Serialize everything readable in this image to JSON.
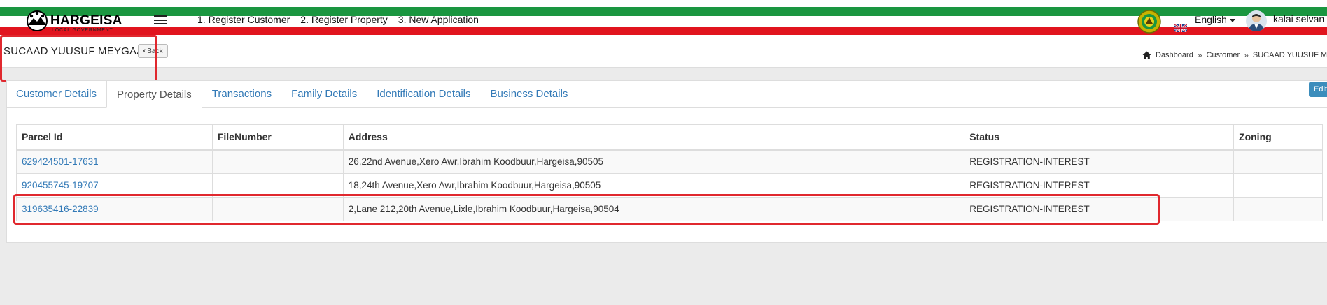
{
  "header": {
    "logo_title": "HARGEISA",
    "logo_subtitle": "LOCAL GOVERNMENT",
    "nav": [
      {
        "label": "1. Register Customer"
      },
      {
        "label": "2. Register Property"
      },
      {
        "label": "3. New Application"
      }
    ],
    "language": "English",
    "username": "kalai selvan"
  },
  "page": {
    "customer_name": "SUCAAD YUUSUF MEYGAAG",
    "back_label": "Back",
    "breadcrumb": [
      "Dashboard",
      "Customer",
      "SUCAAD YUUSUF MEYGAAG"
    ],
    "edit_label": "Edit"
  },
  "tabs": [
    {
      "label": "Customer Details",
      "active": false
    },
    {
      "label": "Property Details",
      "active": true
    },
    {
      "label": "Transactions",
      "active": false
    },
    {
      "label": "Family Details",
      "active": false
    },
    {
      "label": "Identification Details",
      "active": false
    },
    {
      "label": "Business Details",
      "active": false
    }
  ],
  "table": {
    "columns": [
      "Parcel Id",
      "FileNumber",
      "Address",
      "Status",
      "Zoning"
    ],
    "rows": [
      {
        "parcel_id": "629424501-17631",
        "file_number": "",
        "address": "26,22nd Avenue,Xero Awr,Ibrahim Koodbuur,Hargeisa,90505",
        "status": "REGISTRATION-INTEREST",
        "zoning": ""
      },
      {
        "parcel_id": "920455745-19707",
        "file_number": "",
        "address": "18,24th Avenue,Xero Awr,Ibrahim Koodbuur,Hargeisa,90505",
        "status": "REGISTRATION-INTEREST",
        "zoning": ""
      },
      {
        "parcel_id": "319635416-22839",
        "file_number": "",
        "address": "2,Lane 212,20th Avenue,Lixle,Ibrahim Koodbuur,Hargeisa,90504",
        "status": "REGISTRATION-INTEREST",
        "zoning": ""
      }
    ]
  },
  "colors": {
    "flag_green": "#1a9640",
    "flag_red": "#e1141e",
    "link_blue": "#337ab7",
    "highlight_red": "#e0282e"
  }
}
